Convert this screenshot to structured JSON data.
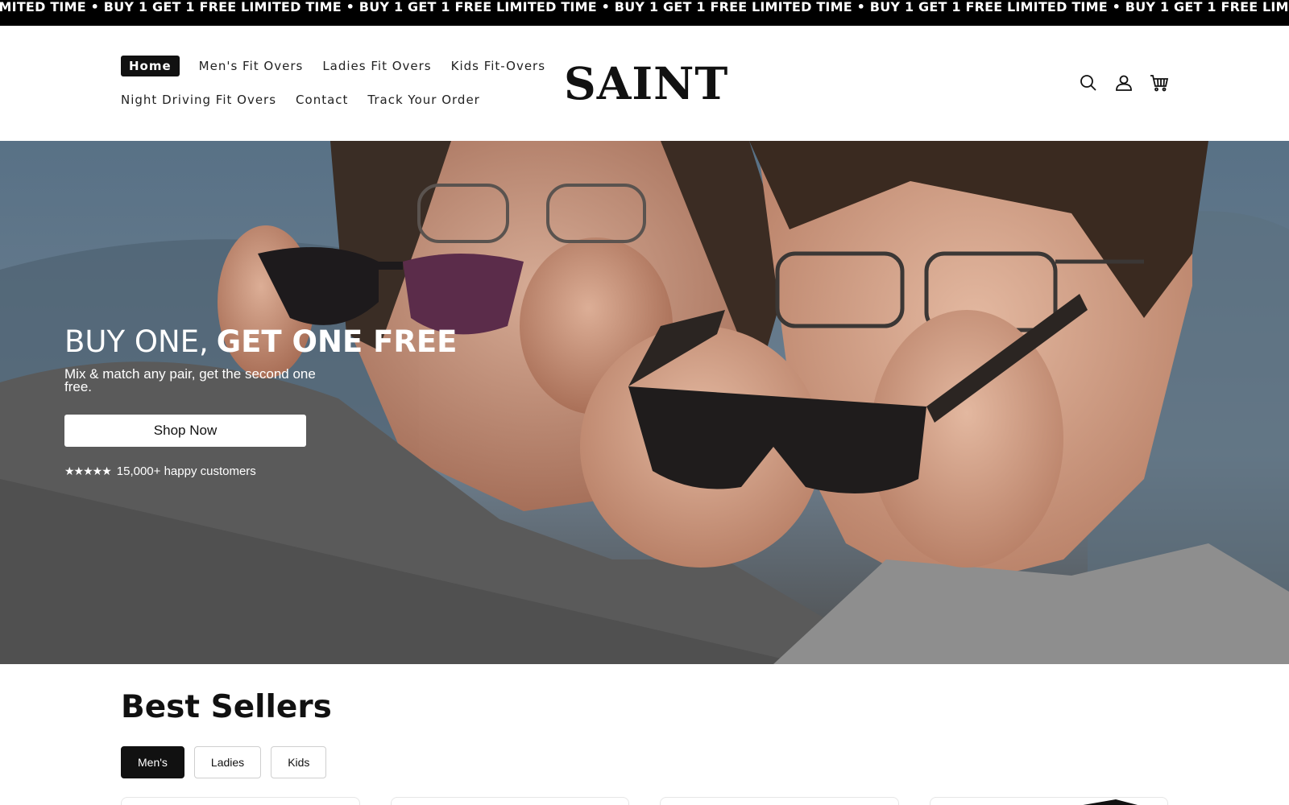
{
  "announcement": {
    "items": [
      "LIMITED TIME • BUY 1 GET 1 FREE",
      "LIMITED TIME • BUY 1 GET 1 FREE",
      "LIMITED TIME • BUY 1 GET 1 FREE",
      "LIMITED TIME • BUY 1 GET 1 FREE",
      "LIMITED TIME • BUY 1 GET 1 FREE",
      "LIMITED TIME • BUY 1 GET 1 FREE"
    ]
  },
  "nav": {
    "row1": [
      "Home",
      "Men's Fit Overs",
      "Ladies Fit Overs",
      "Kids Fit-Overs"
    ],
    "row2": [
      "Night Driving Fit Overs",
      "Contact",
      "Track Your Order"
    ],
    "active": "Home"
  },
  "brand": {
    "logo": "SAINT"
  },
  "header_icons": [
    "search-icon",
    "account-icon",
    "cart-icon"
  ],
  "hero": {
    "title_light": "BUY ONE,",
    "title_bold": "GET ONE FREE",
    "subtitle": "Mix & match any pair, get the second one free.",
    "cta": "Shop Now",
    "stars": "★★★★★",
    "rating_text": "15,000+ happy customers"
  },
  "best_sellers": {
    "title": "Best Sellers",
    "filters": [
      "Men's",
      "Ladies",
      "Kids"
    ],
    "active_filter": "Men's"
  },
  "colors": {
    "primary": "#111111",
    "background": "#ffffff",
    "announcement_bg": "#000000"
  }
}
